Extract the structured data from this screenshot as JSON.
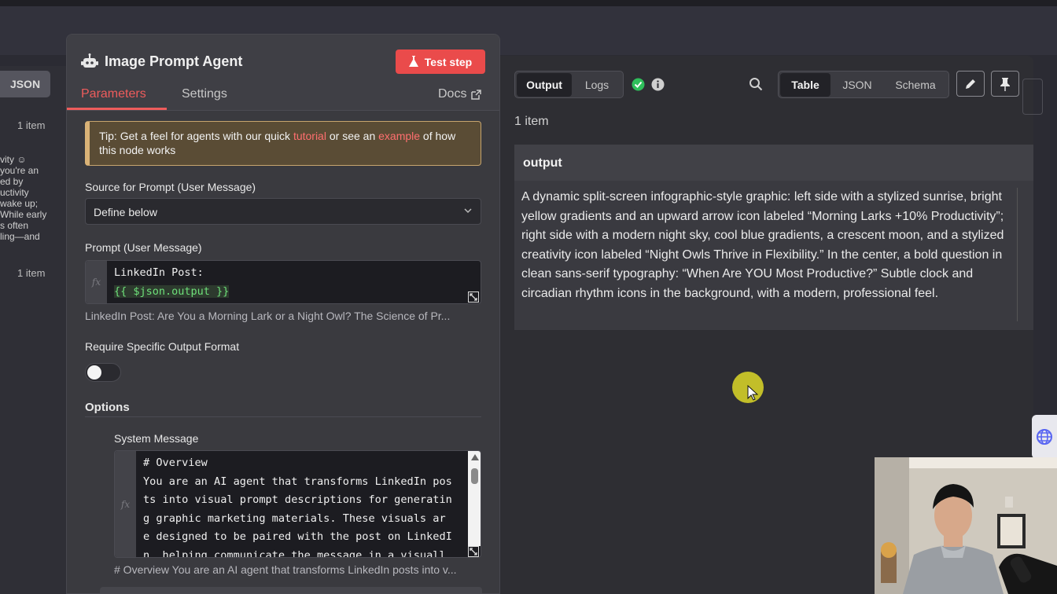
{
  "behind": {
    "json_tab": "JSON",
    "item_count_1": "1 item",
    "item_count_2": "1 item",
    "snippet": "vity ☺\nyou're an\ned by\nuctivity\nwake up;\nWhile early\ns often\nling—and"
  },
  "panel": {
    "title": "Image Prompt Agent",
    "test_step": "Test step",
    "tabs": {
      "parameters": "Parameters",
      "settings": "Settings"
    },
    "docs": "Docs",
    "tip": {
      "part1": "Tip: Get a feel for agents with our quick ",
      "link1": "tutorial",
      "part2": " or see an ",
      "link2": "example",
      "part3": " of how this node works"
    },
    "source_label": "Source for Prompt (User Message)",
    "source_value": "Define below",
    "prompt_label": "Prompt (User Message)",
    "prompt_line1": "LinkedIn Post:",
    "prompt_line2": "{{ $json.output }}",
    "prompt_hint": "LinkedIn Post:  Are You a Morning Lark or a Night Owl? The Science of Pr...",
    "format_label": "Require Specific Output Format",
    "options_label": "Options",
    "system_label": "System Message",
    "system_code": "# Overview\nYou are an AI agent that transforms LinkedIn pos\nts into visual prompt descriptions for generatin\ng graphic marketing materials. These visuals ar\ne designed to be paired with the post on LinkedI\nn, helping communicate the message in a visuall",
    "system_hint": "# Overview You are an AI agent that transforms LinkedIn posts into v..."
  },
  "output": {
    "tabs": {
      "output": "Output",
      "logs": "Logs"
    },
    "views": {
      "table": "Table",
      "json": "JSON",
      "schema": "Schema"
    },
    "item_count": "1 item",
    "column": "output",
    "text": "A dynamic split-screen infographic-style graphic: left side with a stylized sunrise, bright yellow gradients and an upward arrow icon labeled “Morning Larks +10% Productivity”; right side with a modern night sky, cool blue gradients, a crescent moon, and a stylized creativity icon labeled “Night Owls Thrive in Flexibility.” In the center, a bold question in clean sans-serif typography: “When Are YOU Most Productive?” Subtle clock and circadian rhythm icons in the background, with a modern, professional feel."
  },
  "colors": {
    "accent": "#ea4b4b",
    "success": "#2fbf5b"
  }
}
